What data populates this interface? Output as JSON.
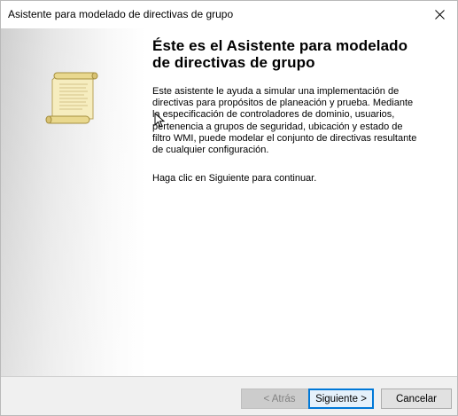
{
  "window": {
    "title": "Asistente para modelado de directivas de grupo"
  },
  "icons": {
    "close": "close-icon",
    "scroll": "scroll-icon",
    "cursor": "mouse-pointer-icon"
  },
  "content": {
    "heading_line1": "Éste es el Asistente para modelado",
    "heading_line2": "de directivas de grupo",
    "paragraph_lines": [
      "Este asistente le ayuda a simular una implementación de",
      "directivas para propósitos de planeación y prueba. Mediante",
      "la especificación de controladores de dominio, usuarios,",
      "pertenencia a grupos de seguridad, ubicación y estado de",
      "filtro WMI, puede modelar el conjunto de directivas resultante",
      "de cualquier configuración."
    ],
    "continue_text": "Haga clic en Siguiente para continuar."
  },
  "footer": {
    "back_label": "< Atrás",
    "next_label": "Siguiente >",
    "cancel_label": "Cancelar"
  },
  "colors": {
    "accent": "#0078d7",
    "scroll_paper": "#f3e9b5"
  }
}
